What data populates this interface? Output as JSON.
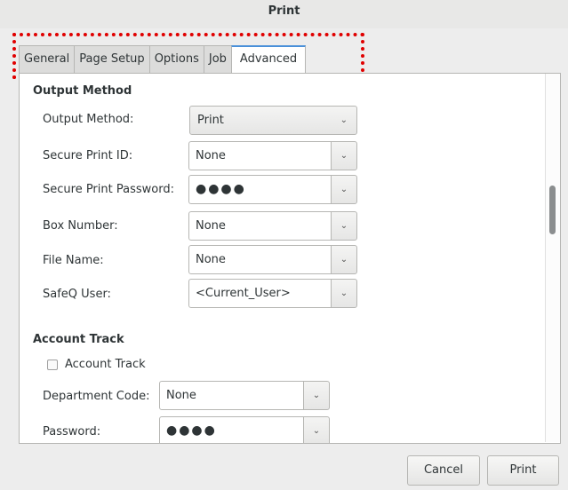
{
  "window": {
    "title": "Print"
  },
  "tabs": [
    {
      "label": "General"
    },
    {
      "label": "Page Setup"
    },
    {
      "label": "Options"
    },
    {
      "label": "Job"
    },
    {
      "label": "Advanced"
    }
  ],
  "output_method": {
    "section_title": "Output Method",
    "output_method_label": "Output Method:",
    "output_method_value": "Print",
    "secure_print_id_label": "Secure Print ID:",
    "secure_print_id_value": "None",
    "secure_print_password_label": "Secure Print Password:",
    "secure_print_password_value": "●●●●",
    "box_number_label": "Box Number:",
    "box_number_value": "None",
    "file_name_label": "File Name:",
    "file_name_value": "None",
    "safeq_user_label": "SafeQ User:",
    "safeq_user_value": "<Current_User>"
  },
  "account_track": {
    "section_title": "Account Track",
    "checkbox_label": "Account Track",
    "checked": false,
    "department_code_label": "Department Code:",
    "department_code_value": "None",
    "password_label": "Password:",
    "password_value": "●●●●"
  },
  "footer": {
    "cancel_label": "Cancel",
    "print_label": "Print"
  },
  "icons": {
    "dropdown": "chevron-down-icon"
  }
}
